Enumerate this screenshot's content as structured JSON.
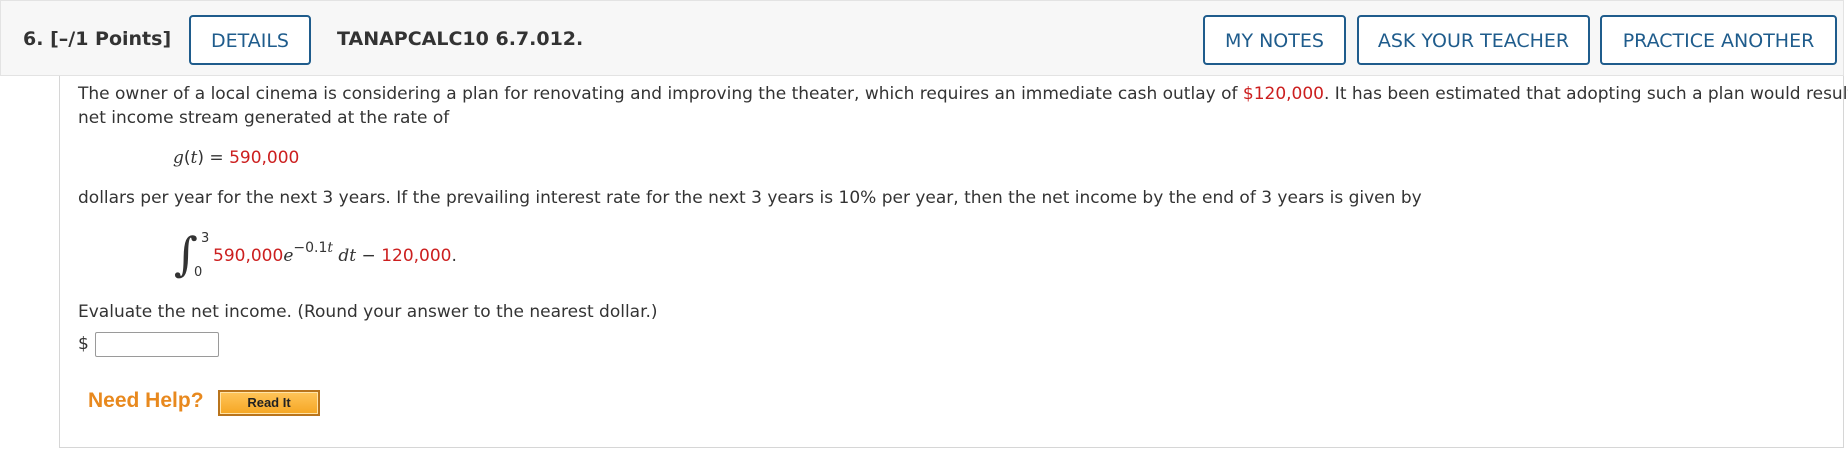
{
  "header": {
    "question_number": "6.",
    "points": "[–/1 Points]",
    "details_label": "DETAILS",
    "problem_id": "TANAPCALC10 6.7.012.",
    "my_notes_label": "MY NOTES",
    "ask_teacher_label": "ASK YOUR TEACHER",
    "practice_another_label": "PRACTICE ANOTHER"
  },
  "problem": {
    "intro_part1": "The owner of a local cinema is considering a plan for renovating and improving the theater, which requires an immediate cash outlay of ",
    "cash_outlay": "$120,000",
    "intro_part2": ". It has been estimated that adopting such a plan would result in a",
    "intro_line2": "net income stream generated at the rate of",
    "eq_lhs_func": "g",
    "eq_lhs_var": "t",
    "eq_equals": " = ",
    "eq_rhs": "590,000",
    "sentence2": "dollars per year for the next 3 years. If the prevailing interest rate for the next 3 years is 10% per year, then the net income by the end of 3 years is given by",
    "integral": {
      "upper": "3",
      "lower": "0",
      "coefficient": "590,000",
      "base": "e",
      "exponent_num": "−0.1",
      "exponent_var": "t",
      "differential": "dt",
      "minus": " − ",
      "constant": "120,000",
      "period": "."
    },
    "instruction": "Evaluate the net income. (Round your answer to the nearest dollar.)",
    "currency_symbol": "$",
    "answer_value": ""
  },
  "help": {
    "need_help_label": "Need Help?",
    "read_it_label": "Read It"
  },
  "colors": {
    "accent_blue": "#1f5c8c",
    "value_red": "#cc1f1f",
    "help_orange": "#e8891e"
  }
}
